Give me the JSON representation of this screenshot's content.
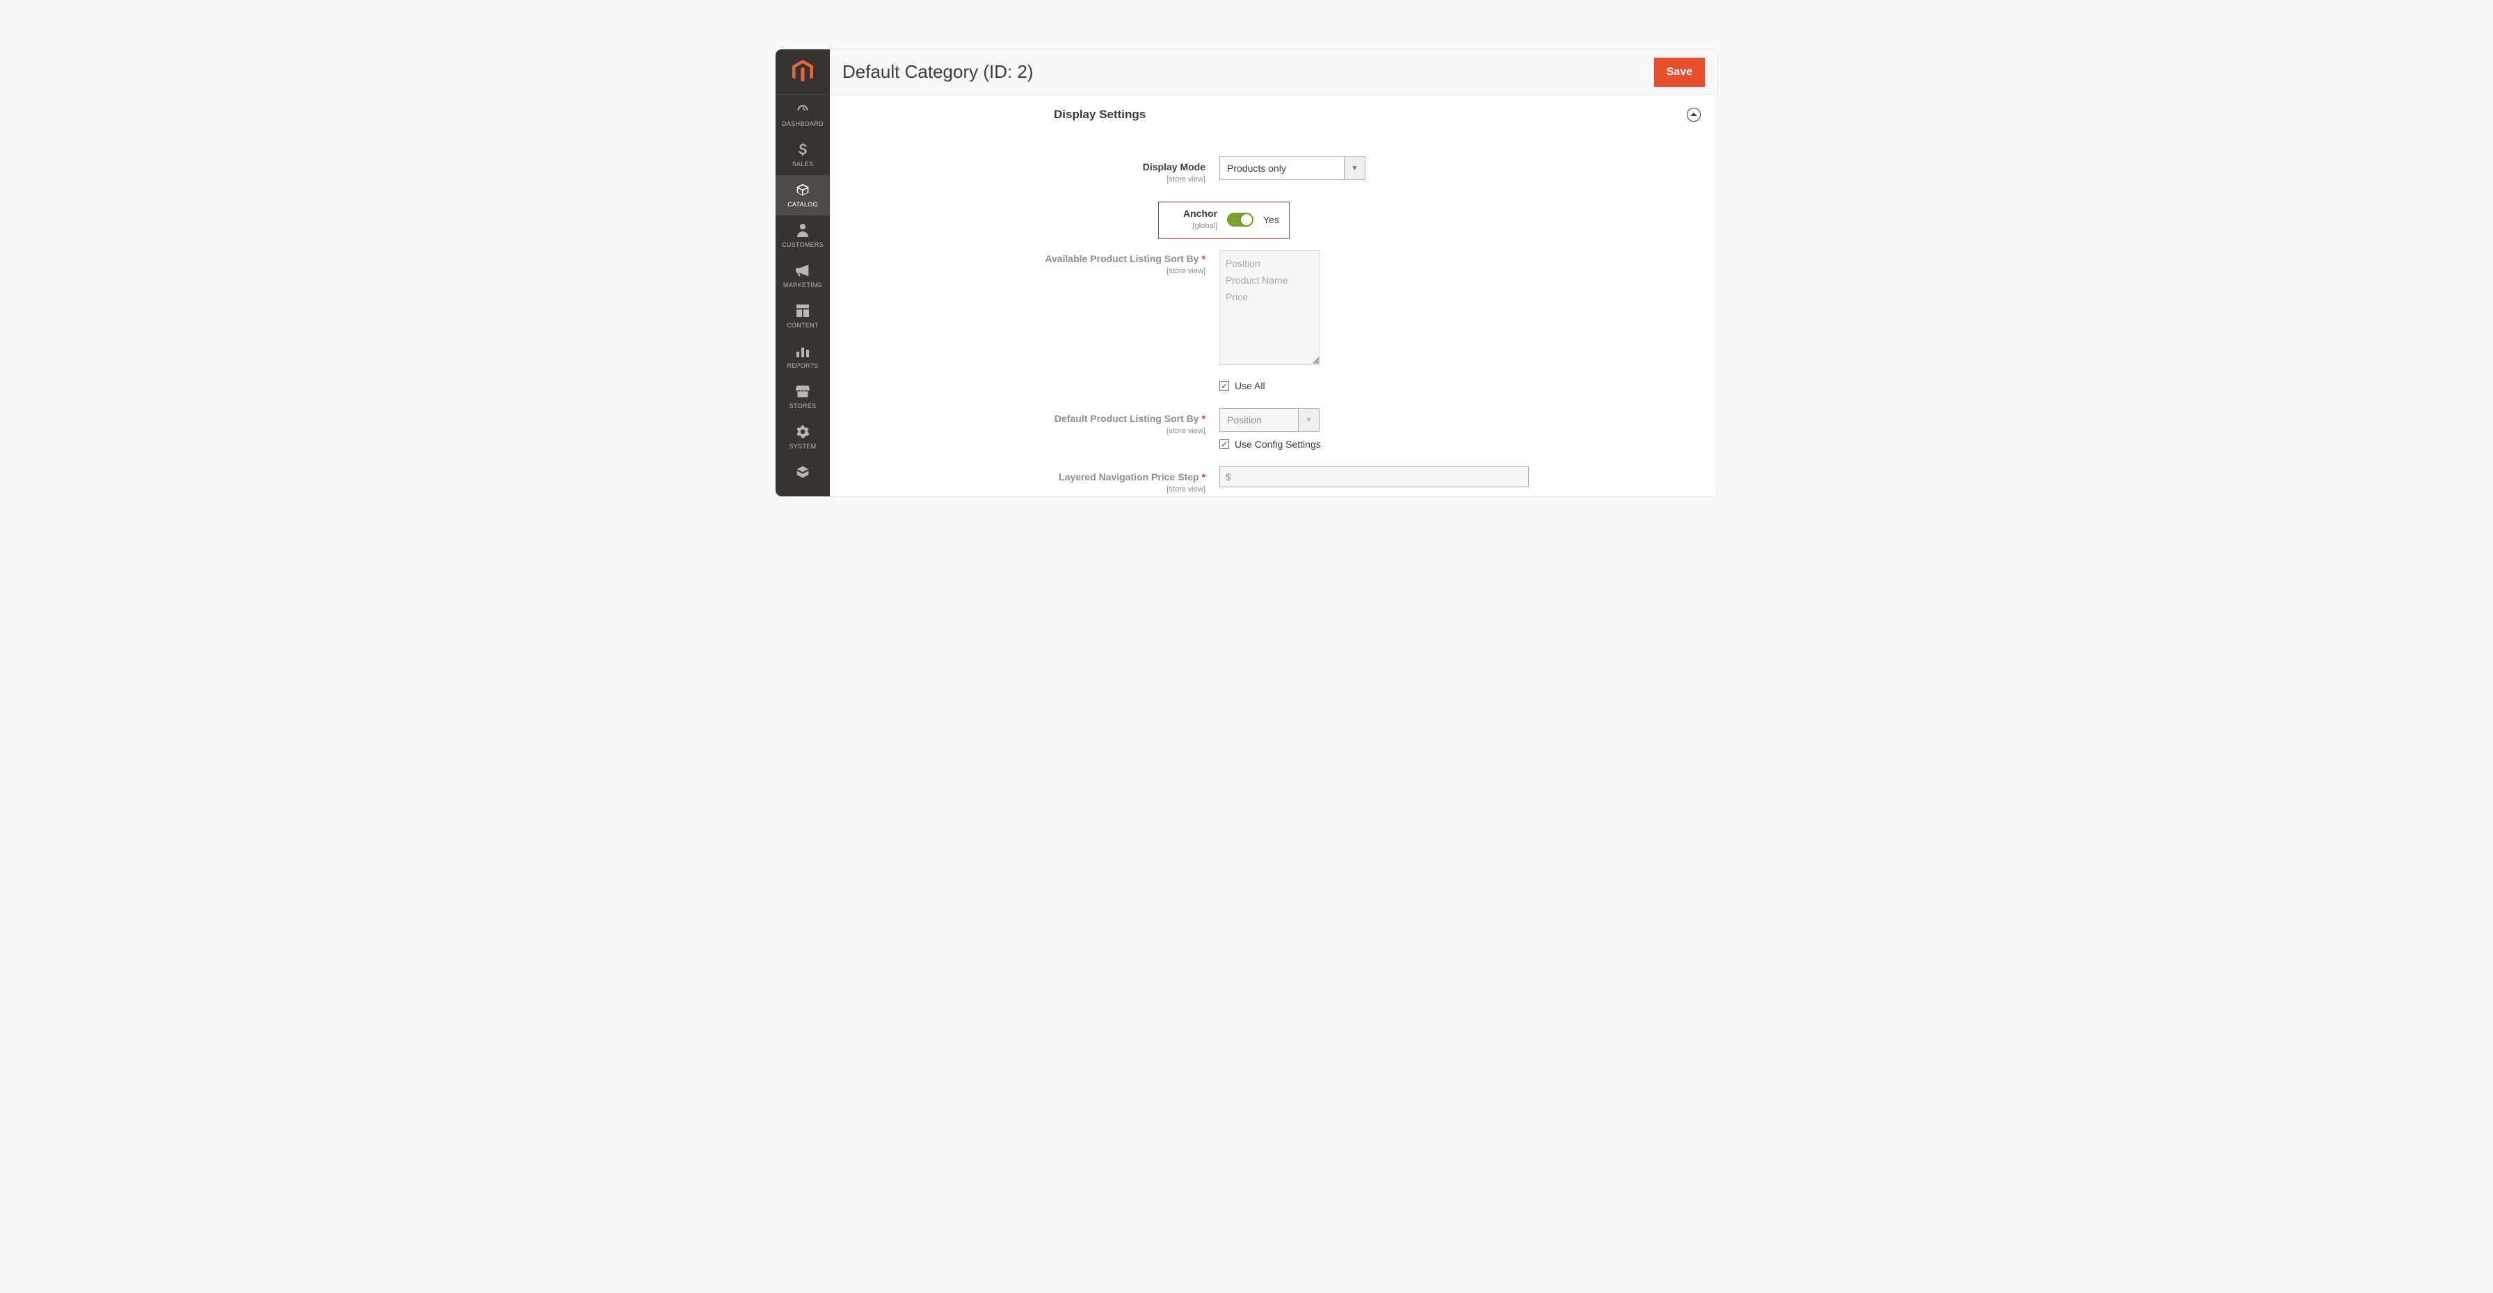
{
  "header": {
    "title": "Default Category (ID: 2)",
    "save": "Save"
  },
  "sidebar": {
    "items": [
      {
        "name": "dashboard",
        "label": "DASHBOARD"
      },
      {
        "name": "sales",
        "label": "SALES"
      },
      {
        "name": "catalog",
        "label": "CATALOG"
      },
      {
        "name": "customers",
        "label": "CUSTOMERS"
      },
      {
        "name": "marketing",
        "label": "MARKETING"
      },
      {
        "name": "content",
        "label": "CONTENT"
      },
      {
        "name": "reports",
        "label": "REPORTS"
      },
      {
        "name": "stores",
        "label": "STORES"
      },
      {
        "name": "system",
        "label": "SYSTEM"
      }
    ]
  },
  "section": {
    "title": "Display Settings"
  },
  "fields": {
    "display_mode": {
      "label": "Display Mode",
      "scope": "[store view]",
      "value": "Products only"
    },
    "anchor": {
      "label": "Anchor",
      "scope": "[global]",
      "value": "Yes"
    },
    "available_sort": {
      "label": "Available Product Listing Sort By",
      "scope": "[store view]",
      "options": [
        "Position",
        "Product Name",
        "Price"
      ],
      "use_all": "Use All"
    },
    "default_sort": {
      "label": "Default Product Listing Sort By",
      "scope": "[store view]",
      "value": "Position",
      "use_config": "Use Config Settings"
    },
    "price_step": {
      "label": "Layered Navigation Price Step",
      "scope": "[store view]",
      "prefix": "$"
    }
  }
}
